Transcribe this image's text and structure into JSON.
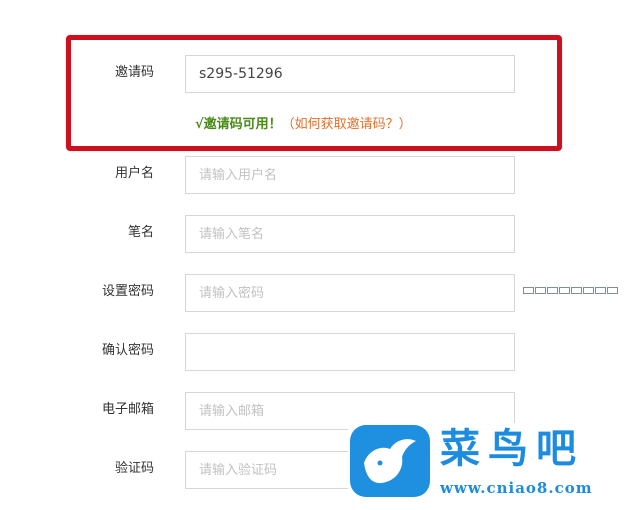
{
  "form": {
    "invite": {
      "label": "邀请码",
      "value": "s295-51296",
      "ok_msg": "√邀请码可用！",
      "help_link": "（如何获取邀请码？）"
    },
    "username": {
      "label": "用户名",
      "placeholder": "请输入用户名"
    },
    "signature": {
      "label": "笔名",
      "placeholder": "请输入笔名"
    },
    "password": {
      "label": "设置密码",
      "placeholder": "请输入密码"
    },
    "confirm": {
      "label": "确认密码",
      "placeholder": ""
    },
    "email": {
      "label": "电子邮箱",
      "placeholder": "请输入邮箱"
    },
    "captcha": {
      "label": "验证码",
      "placeholder": "请输入验证码"
    }
  },
  "colors": {
    "highlight": "#cc1020",
    "ok": "#4a8a1a",
    "help": "#e0702a",
    "brand": "#1c8be0"
  },
  "watermark": {
    "title": "菜鸟吧",
    "url": "www.cniao8.com",
    "logo_icon": "bird-icon"
  }
}
